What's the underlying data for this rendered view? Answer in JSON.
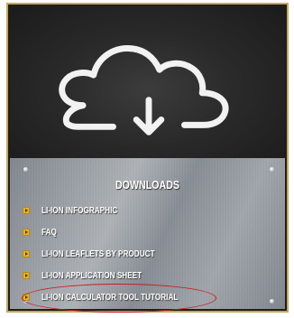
{
  "header": {
    "icon": "cloud-download-icon"
  },
  "downloads": {
    "title": "DOWNLOADS",
    "items": [
      {
        "label": "LI-ION INFOGRAPHIC"
      },
      {
        "label": "FAQ"
      },
      {
        "label": "LI-ION LEAFLETS BY PRODUCT"
      },
      {
        "label": "LI-ION APPLICATION SHEET"
      },
      {
        "label": "LI-ION CALCULATOR TOOL TUTORIAL"
      }
    ]
  },
  "colors": {
    "frame_border": "#c9a85a",
    "bullet": "#e6b422",
    "highlight": "#c81e1e"
  }
}
